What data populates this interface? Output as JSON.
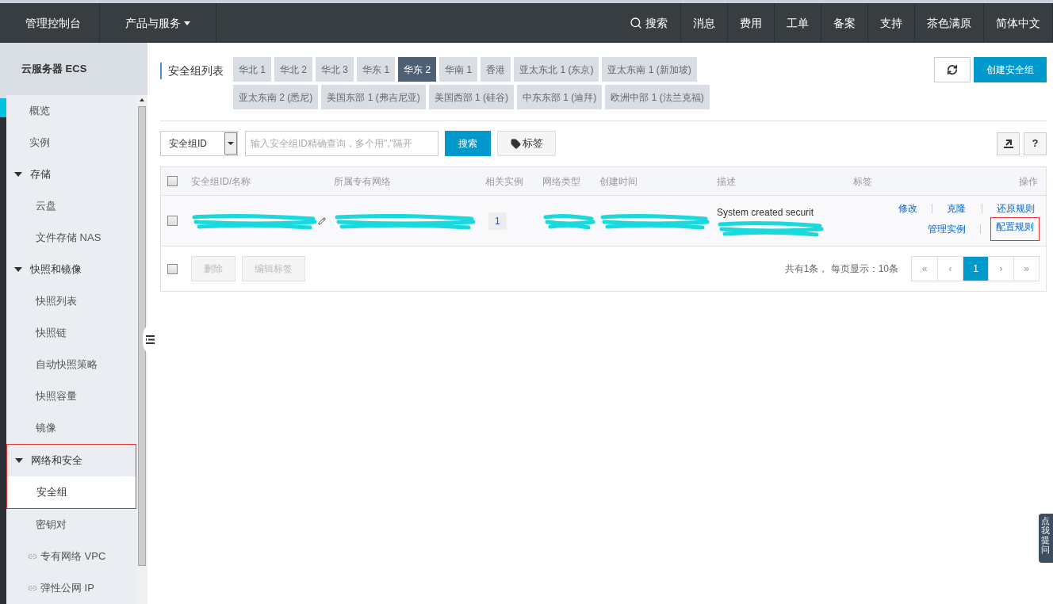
{
  "topbar": {
    "brand": "管理控制台",
    "products": "产品与服务",
    "search": "搜索",
    "links": [
      "消息",
      "费用",
      "工单",
      "备案",
      "支持",
      "茶色满原",
      "简体中文"
    ]
  },
  "sidebar": {
    "title": "云服务器 ECS",
    "items": [
      {
        "kind": "link",
        "label": "概览",
        "selected": false
      },
      {
        "kind": "link",
        "label": "实例",
        "selected": false
      },
      {
        "kind": "group",
        "label": "存储",
        "expanded": true,
        "annotated": false,
        "children": [
          {
            "label": "云盘",
            "selected": false
          },
          {
            "label": "文件存储 NAS",
            "selected": false
          }
        ]
      },
      {
        "kind": "group",
        "label": "快照和镜像",
        "expanded": true,
        "annotated": false,
        "children": [
          {
            "label": "快照列表",
            "selected": false
          },
          {
            "label": "快照链",
            "selected": false
          },
          {
            "label": "自动快照策略",
            "selected": false
          },
          {
            "label": "快照容量",
            "selected": false
          },
          {
            "label": "镜像",
            "selected": false
          }
        ]
      },
      {
        "kind": "group",
        "label": "网络和安全",
        "expanded": true,
        "annotated": true,
        "children": [
          {
            "label": "安全组",
            "selected": true
          },
          {
            "label": "密钥对",
            "selected": false
          }
        ]
      },
      {
        "kind": "external",
        "label": "专有网络 VPC",
        "selected": false
      },
      {
        "kind": "external",
        "label": "弹性公网 IP",
        "selected": false
      }
    ]
  },
  "main": {
    "title": "安全组列表",
    "regions": [
      {
        "label": "华北 1",
        "selected": false
      },
      {
        "label": "华北 2",
        "selected": false
      },
      {
        "label": "华北 3",
        "selected": false
      },
      {
        "label": "华东 1",
        "selected": false
      },
      {
        "label": "华东 2",
        "selected": true
      },
      {
        "label": "华南 1",
        "selected": false
      },
      {
        "label": "香港",
        "selected": false
      },
      {
        "label": "亚太东北 1 (东京)",
        "selected": false
      },
      {
        "label": "亚太东南 1 (新加坡)",
        "selected": false
      },
      {
        "label": "亚太东南 2 (悉尼)",
        "selected": false
      },
      {
        "label": "美国东部 1 (弗吉尼亚)",
        "selected": false
      },
      {
        "label": "美国西部 1 (硅谷)",
        "selected": false
      },
      {
        "label": "中东东部 1 (迪拜)",
        "selected": false
      },
      {
        "label": "欧洲中部 1 (法兰克福)",
        "selected": false
      }
    ],
    "create_button": "创建安全组",
    "filter": {
      "field": "安全组ID",
      "placeholder": "输入安全组ID精确查询，多个用\",\"隔开",
      "search_button": "搜索",
      "tag_button": "标签"
    },
    "help_button": "?",
    "table": {
      "header_checked": false,
      "columns": [
        "安全组ID/名称",
        "所属专有网络",
        "相关实例",
        "网络类型",
        "创建时间",
        "描述",
        "标签",
        "操作"
      ],
      "rows": [
        {
          "checked": false,
          "instances": "1",
          "description": "System created securit",
          "actions": [
            {
              "label": "修改",
              "annotated": false
            },
            {
              "label": "克隆",
              "annotated": false
            },
            {
              "label": "还原规则",
              "annotated": false
            },
            {
              "label": "管理实例",
              "annotated": false
            },
            {
              "label": "配置规则",
              "annotated": true
            }
          ]
        }
      ],
      "footer": {
        "checked": false,
        "buttons": [
          {
            "label": "删除",
            "disabled": true
          },
          {
            "label": "编辑标签",
            "disabled": true
          }
        ],
        "summary": "共有1条， 每页显示：10条",
        "pages": [
          {
            "label": "«",
            "selected": false
          },
          {
            "label": "‹",
            "selected": false
          },
          {
            "label": "1",
            "selected": true
          },
          {
            "label": "›",
            "selected": false
          },
          {
            "label": "»",
            "selected": false
          }
        ]
      }
    }
  },
  "float_tab": "点我提问"
}
